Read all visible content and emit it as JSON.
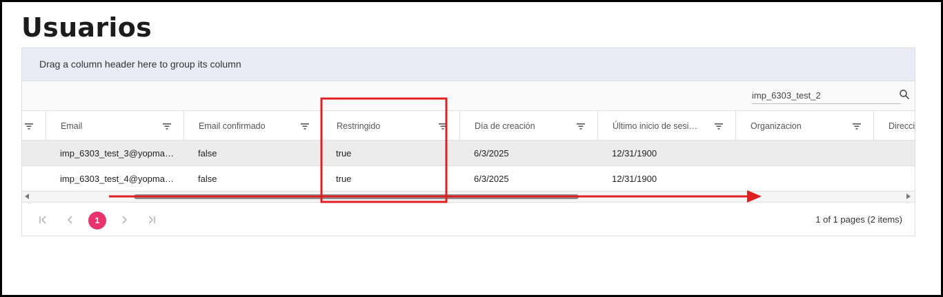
{
  "page": {
    "title": "Usuarios"
  },
  "group_panel": {
    "text": "Drag a column header here to group its column"
  },
  "search": {
    "value": "imp_6303_test_2"
  },
  "columns": [
    {
      "label": "Email"
    },
    {
      "label": "Email confirmado"
    },
    {
      "label": "Restringido"
    },
    {
      "label": "Día de creación"
    },
    {
      "label": "Último inicio de sesi…"
    },
    {
      "label": "Organizacion"
    },
    {
      "label": "Direcci"
    }
  ],
  "rows": [
    {
      "email": "imp_6303_test_3@yopma…",
      "email_confirmed": "false",
      "restricted": "true",
      "created": "6/3/2025",
      "last_login": "12/31/1900",
      "selected": true
    },
    {
      "email": "imp_6303_test_4@yopma…",
      "email_confirmed": "false",
      "restricted": "true",
      "created": "6/3/2025",
      "last_login": "12/31/1900",
      "selected": false
    }
  ],
  "pager": {
    "current_page": "1",
    "info": "1 of 1 pages (2 items)"
  },
  "colors": {
    "accent": "#e8336d",
    "annotation": "#e02020",
    "group_panel_bg": "#e9ecf5"
  },
  "icons": [
    "search-icon",
    "filter-icon",
    "first-page-icon",
    "prev-page-icon",
    "next-page-icon",
    "last-page-icon"
  ]
}
